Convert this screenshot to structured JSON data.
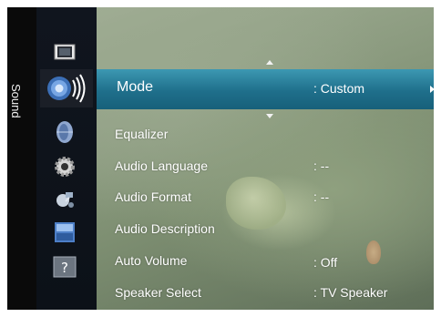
{
  "sidebar": {
    "section_label": "Sound",
    "icons": [
      {
        "name": "picture-icon",
        "active": false
      },
      {
        "name": "sound-icon",
        "active": true
      },
      {
        "name": "channel-icon",
        "active": false
      },
      {
        "name": "setup-icon",
        "active": false
      },
      {
        "name": "input-icon",
        "active": false
      },
      {
        "name": "application-icon",
        "active": false
      },
      {
        "name": "support-icon",
        "active": false
      }
    ]
  },
  "menu": {
    "selected": {
      "label": "Mode",
      "value": ": Custom"
    },
    "items": [
      {
        "label": "Equalizer",
        "value": ""
      },
      {
        "label": "Audio Language",
        "value": ": --"
      },
      {
        "label": "Audio Format",
        "value": ": --"
      },
      {
        "label": "Audio Description",
        "value": ""
      },
      {
        "label": "Auto Volume",
        "value": ": Off"
      },
      {
        "label": "Speaker Select",
        "value": ": TV Speaker"
      }
    ]
  },
  "colors": {
    "highlight": "#2a86a2",
    "text": "#ffffff",
    "sidebar_bg": "#0e131b"
  }
}
